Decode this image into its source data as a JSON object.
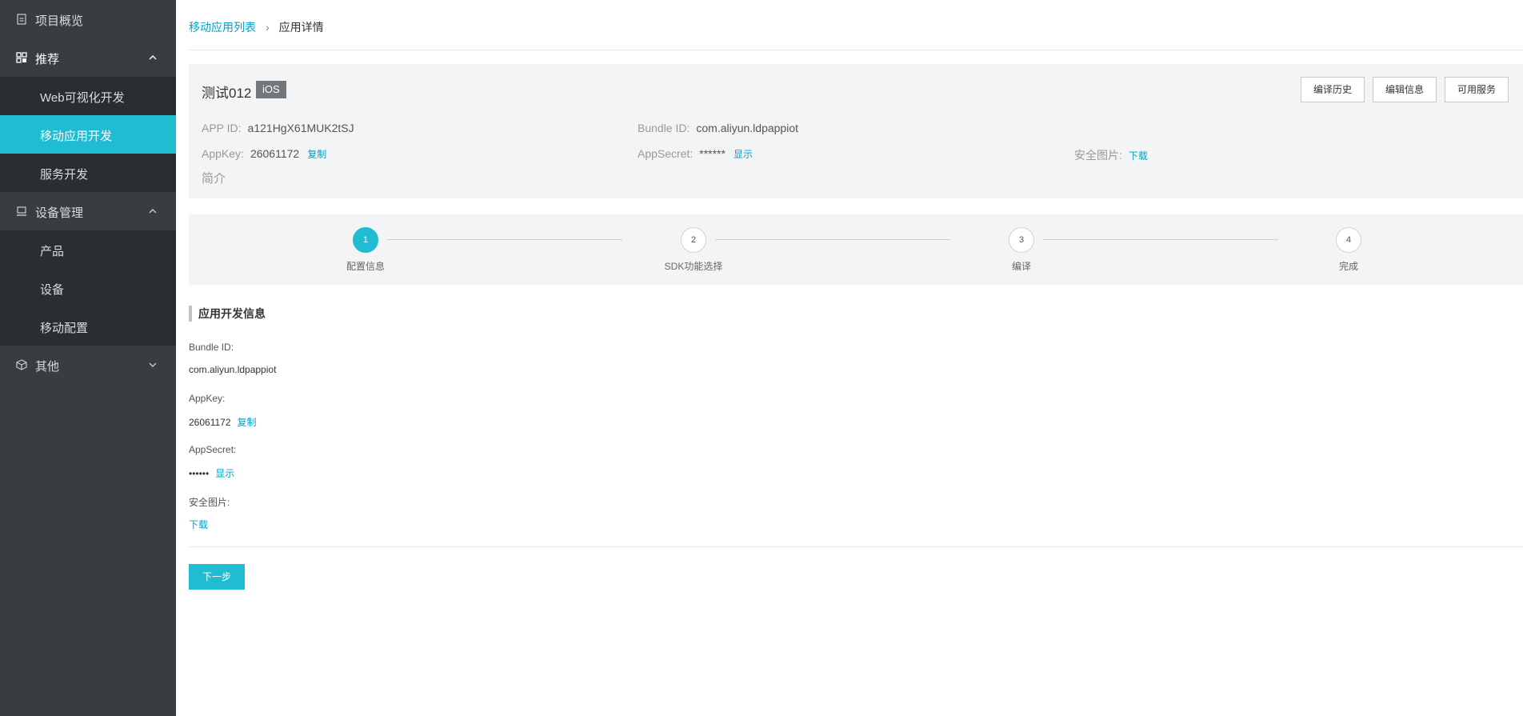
{
  "sidebar": {
    "overview": "项目概览",
    "recommend": {
      "label": "推荐",
      "items": [
        "Web可视化开发",
        "移动应用开发",
        "服务开发"
      ]
    },
    "device_mgmt": {
      "label": "设备管理",
      "items": [
        "产品",
        "设备",
        "移动配置"
      ]
    },
    "other": "其他"
  },
  "breadcrumb": {
    "parent": "移动应用列表",
    "separator": "›",
    "current": "应用详情"
  },
  "app": {
    "name": "测试012",
    "platform": "iOS",
    "buttons": [
      "编译历史",
      "编辑信息",
      "可用服务"
    ],
    "app_id_label": "APP ID:",
    "app_id": "a121HgX61MUK2tSJ",
    "bundle_id_label": "Bundle ID:",
    "bundle_id": "com.aliyun.ldpappiot",
    "appkey_label": "AppKey:",
    "appkey": "26061172",
    "copy": "复制",
    "appsecret_label": "AppSecret:",
    "appsecret": "******",
    "show": "显示",
    "security_image_label": "安全图片:",
    "download": "下载",
    "intro": "简介"
  },
  "steps": [
    {
      "num": "1",
      "label": "配置信息"
    },
    {
      "num": "2",
      "label": "SDK功能选择"
    },
    {
      "num": "3",
      "label": "编译"
    },
    {
      "num": "4",
      "label": "完成"
    }
  ],
  "dev_info": {
    "title": "应用开发信息",
    "bundle_id_label": "Bundle ID:",
    "bundle_id": "com.aliyun.ldpappiot",
    "appkey_label": "AppKey:",
    "appkey": "26061172",
    "copy": "复制",
    "appsecret_label": "AppSecret:",
    "appsecret": "••••••",
    "show": "显示",
    "security_image_label": "安全图片:",
    "download": "下载",
    "next": "下一步"
  },
  "colors": {
    "accent": "#1fbcd2",
    "sidebar_bg": "#373d41",
    "submenu_bg": "#2a2e31",
    "link": "#00a2ca"
  }
}
